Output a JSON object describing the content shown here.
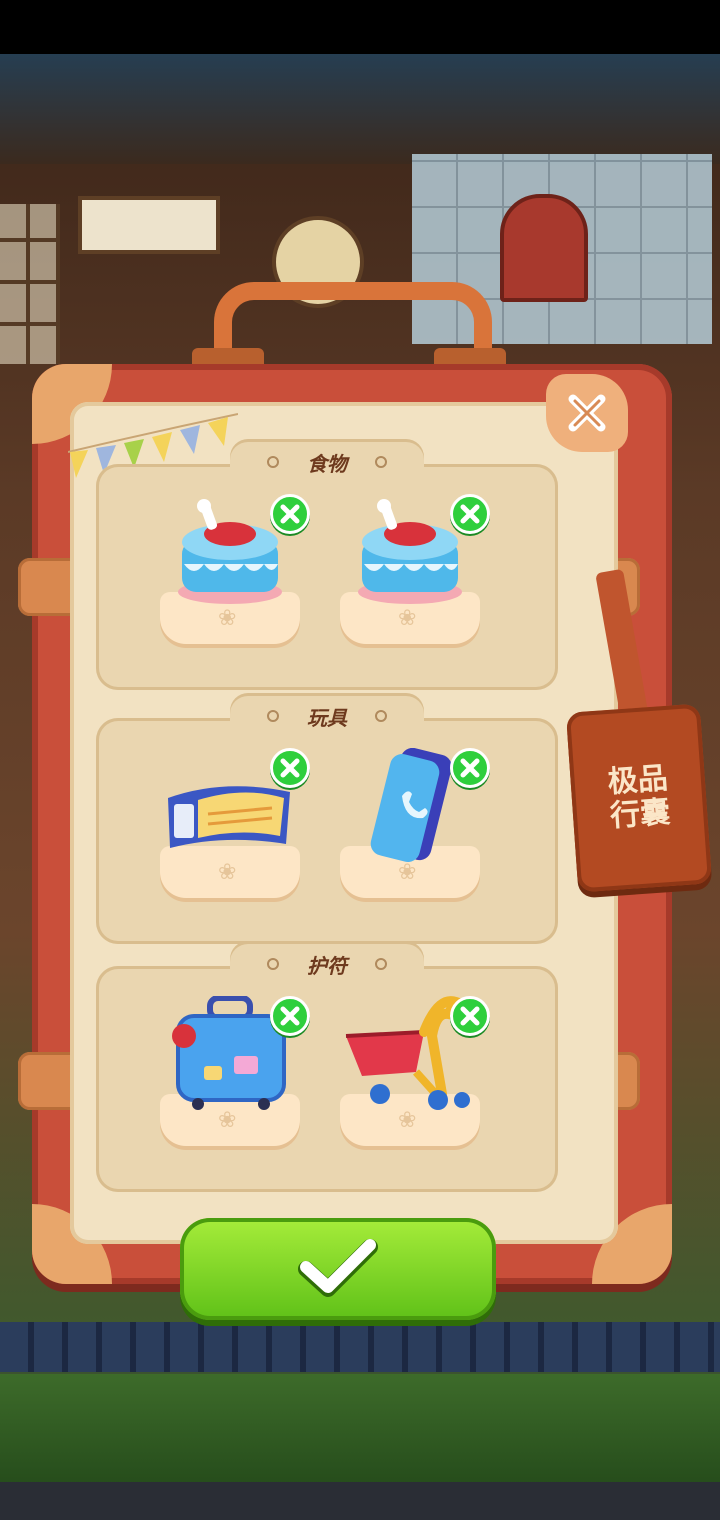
{
  "panel": {
    "tag_lines": [
      "极品",
      "行囊"
    ]
  },
  "sections": [
    {
      "title": "食物",
      "items": [
        {
          "name": "cake-icon",
          "kind": "cake"
        },
        {
          "name": "cake-icon",
          "kind": "cake"
        }
      ]
    },
    {
      "title": "玩具",
      "items": [
        {
          "name": "ticket-icon",
          "kind": "ticket"
        },
        {
          "name": "phone-icon",
          "kind": "phone"
        }
      ]
    },
    {
      "title": "护符",
      "items": [
        {
          "name": "suitcase-icon",
          "kind": "suitcase"
        },
        {
          "name": "stroller-icon",
          "kind": "stroller"
        }
      ]
    }
  ],
  "colors": {
    "accent_green": "#2ecf3c",
    "case_red": "#c94f3a",
    "panel_cream": "#f2e2c2"
  }
}
